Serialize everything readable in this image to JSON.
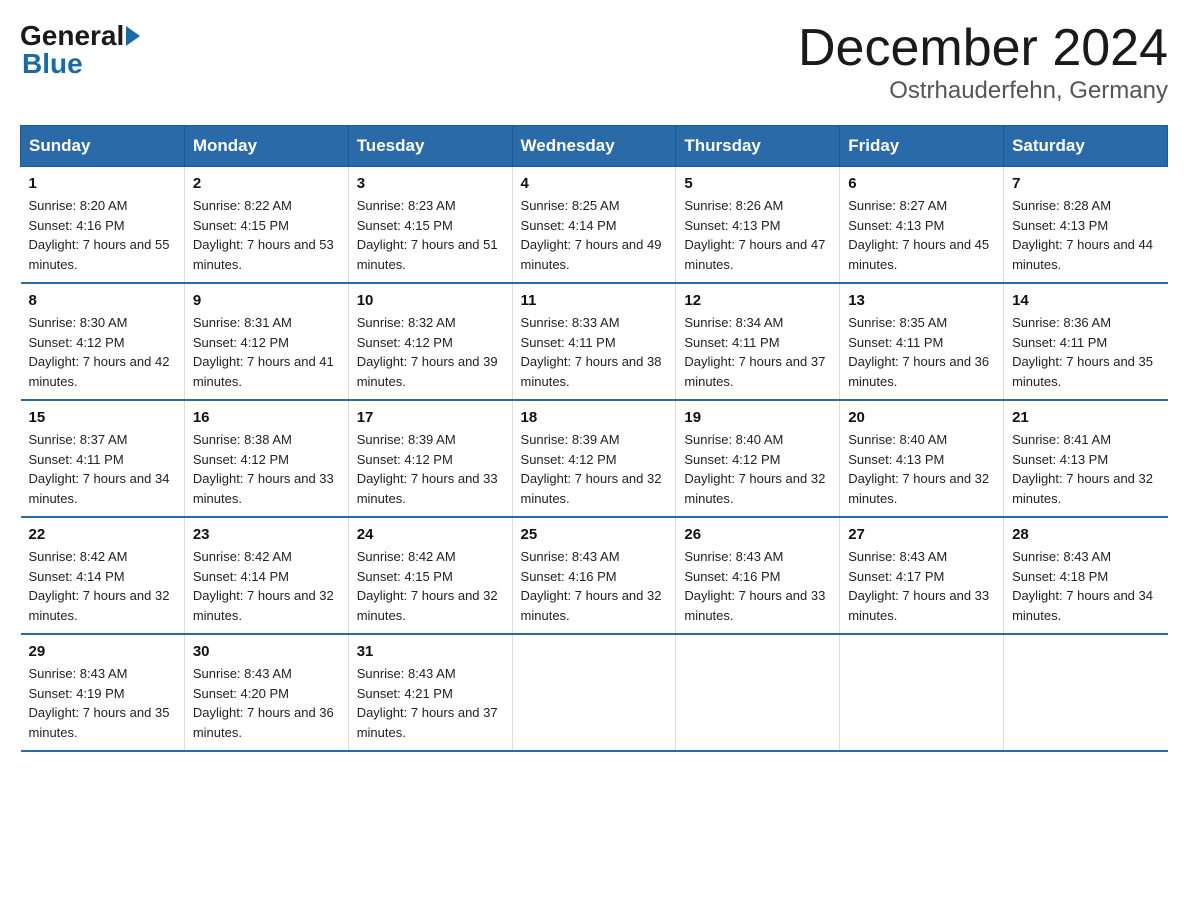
{
  "logo": {
    "general": "General",
    "blue": "Blue"
  },
  "title": "December 2024",
  "location": "Ostrhauderfehn, Germany",
  "headers": [
    "Sunday",
    "Monday",
    "Tuesday",
    "Wednesday",
    "Thursday",
    "Friday",
    "Saturday"
  ],
  "weeks": [
    [
      {
        "day": "1",
        "sunrise": "8:20 AM",
        "sunset": "4:16 PM",
        "daylight": "7 hours and 55 minutes."
      },
      {
        "day": "2",
        "sunrise": "8:22 AM",
        "sunset": "4:15 PM",
        "daylight": "7 hours and 53 minutes."
      },
      {
        "day": "3",
        "sunrise": "8:23 AM",
        "sunset": "4:15 PM",
        "daylight": "7 hours and 51 minutes."
      },
      {
        "day": "4",
        "sunrise": "8:25 AM",
        "sunset": "4:14 PM",
        "daylight": "7 hours and 49 minutes."
      },
      {
        "day": "5",
        "sunrise": "8:26 AM",
        "sunset": "4:13 PM",
        "daylight": "7 hours and 47 minutes."
      },
      {
        "day": "6",
        "sunrise": "8:27 AM",
        "sunset": "4:13 PM",
        "daylight": "7 hours and 45 minutes."
      },
      {
        "day": "7",
        "sunrise": "8:28 AM",
        "sunset": "4:13 PM",
        "daylight": "7 hours and 44 minutes."
      }
    ],
    [
      {
        "day": "8",
        "sunrise": "8:30 AM",
        "sunset": "4:12 PM",
        "daylight": "7 hours and 42 minutes."
      },
      {
        "day": "9",
        "sunrise": "8:31 AM",
        "sunset": "4:12 PM",
        "daylight": "7 hours and 41 minutes."
      },
      {
        "day": "10",
        "sunrise": "8:32 AM",
        "sunset": "4:12 PM",
        "daylight": "7 hours and 39 minutes."
      },
      {
        "day": "11",
        "sunrise": "8:33 AM",
        "sunset": "4:11 PM",
        "daylight": "7 hours and 38 minutes."
      },
      {
        "day": "12",
        "sunrise": "8:34 AM",
        "sunset": "4:11 PM",
        "daylight": "7 hours and 37 minutes."
      },
      {
        "day": "13",
        "sunrise": "8:35 AM",
        "sunset": "4:11 PM",
        "daylight": "7 hours and 36 minutes."
      },
      {
        "day": "14",
        "sunrise": "8:36 AM",
        "sunset": "4:11 PM",
        "daylight": "7 hours and 35 minutes."
      }
    ],
    [
      {
        "day": "15",
        "sunrise": "8:37 AM",
        "sunset": "4:11 PM",
        "daylight": "7 hours and 34 minutes."
      },
      {
        "day": "16",
        "sunrise": "8:38 AM",
        "sunset": "4:12 PM",
        "daylight": "7 hours and 33 minutes."
      },
      {
        "day": "17",
        "sunrise": "8:39 AM",
        "sunset": "4:12 PM",
        "daylight": "7 hours and 33 minutes."
      },
      {
        "day": "18",
        "sunrise": "8:39 AM",
        "sunset": "4:12 PM",
        "daylight": "7 hours and 32 minutes."
      },
      {
        "day": "19",
        "sunrise": "8:40 AM",
        "sunset": "4:12 PM",
        "daylight": "7 hours and 32 minutes."
      },
      {
        "day": "20",
        "sunrise": "8:40 AM",
        "sunset": "4:13 PM",
        "daylight": "7 hours and 32 minutes."
      },
      {
        "day": "21",
        "sunrise": "8:41 AM",
        "sunset": "4:13 PM",
        "daylight": "7 hours and 32 minutes."
      }
    ],
    [
      {
        "day": "22",
        "sunrise": "8:42 AM",
        "sunset": "4:14 PM",
        "daylight": "7 hours and 32 minutes."
      },
      {
        "day": "23",
        "sunrise": "8:42 AM",
        "sunset": "4:14 PM",
        "daylight": "7 hours and 32 minutes."
      },
      {
        "day": "24",
        "sunrise": "8:42 AM",
        "sunset": "4:15 PM",
        "daylight": "7 hours and 32 minutes."
      },
      {
        "day": "25",
        "sunrise": "8:43 AM",
        "sunset": "4:16 PM",
        "daylight": "7 hours and 32 minutes."
      },
      {
        "day": "26",
        "sunrise": "8:43 AM",
        "sunset": "4:16 PM",
        "daylight": "7 hours and 33 minutes."
      },
      {
        "day": "27",
        "sunrise": "8:43 AM",
        "sunset": "4:17 PM",
        "daylight": "7 hours and 33 minutes."
      },
      {
        "day": "28",
        "sunrise": "8:43 AM",
        "sunset": "4:18 PM",
        "daylight": "7 hours and 34 minutes."
      }
    ],
    [
      {
        "day": "29",
        "sunrise": "8:43 AM",
        "sunset": "4:19 PM",
        "daylight": "7 hours and 35 minutes."
      },
      {
        "day": "30",
        "sunrise": "8:43 AM",
        "sunset": "4:20 PM",
        "daylight": "7 hours and 36 minutes."
      },
      {
        "day": "31",
        "sunrise": "8:43 AM",
        "sunset": "4:21 PM",
        "daylight": "7 hours and 37 minutes."
      },
      null,
      null,
      null,
      null
    ]
  ]
}
